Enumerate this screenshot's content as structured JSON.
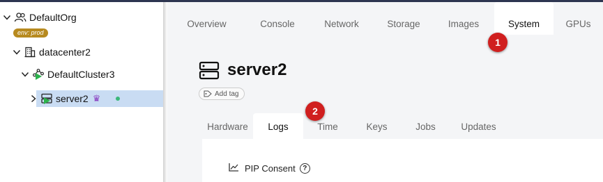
{
  "sidebar": {
    "org": {
      "label": "DefaultOrg",
      "badge": "env: prod"
    },
    "datacenter": {
      "label": "datacenter2"
    },
    "cluster": {
      "label": "DefaultCluster3"
    },
    "server": {
      "label": "server2",
      "crown_glyph": "♛"
    }
  },
  "top_tabs": [
    "Overview",
    "Console",
    "Network",
    "Storage",
    "Images",
    "System",
    "GPUs"
  ],
  "top_tabs_active": "System",
  "badges": {
    "first": "1",
    "second": "2"
  },
  "page": {
    "title": "server2",
    "add_tag_label": "Add tag"
  },
  "sub_tabs": [
    "Hardware",
    "Logs",
    "Time",
    "Keys",
    "Jobs",
    "Updates"
  ],
  "sub_tabs_active": "Logs",
  "section": {
    "title": "PIP Consent",
    "help_glyph": "?"
  },
  "colors": {
    "selection": "#c9dcf3",
    "badge_red": "#d01f1f",
    "env_badge": "#b78a1f",
    "run_green": "#2bb24c",
    "crown_purple": "#8a3fc0"
  },
  "icons": [
    "users-icon",
    "building-icon",
    "cluster-icon",
    "server-icon",
    "crown-icon",
    "tag-icon",
    "chart-line-icon",
    "help-circle-icon"
  ]
}
